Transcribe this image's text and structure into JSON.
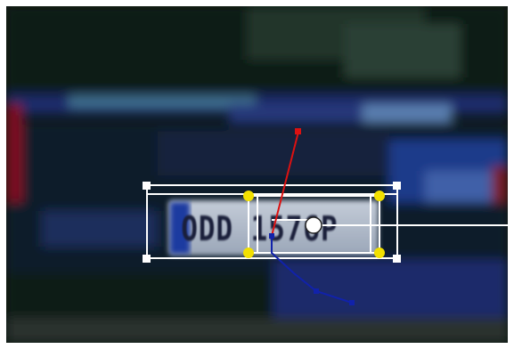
{
  "plate": {
    "text": "ODD 1576P"
  },
  "overlay": {
    "box_color": "#ffffff",
    "axis_colors": {
      "x": "#ffffff",
      "y": "#dd1111",
      "z": "#1122aa"
    },
    "corner_handle_color": "#ffffff",
    "inner_handle_color": "#f2e000",
    "center_handle_color": "#ffffff"
  }
}
